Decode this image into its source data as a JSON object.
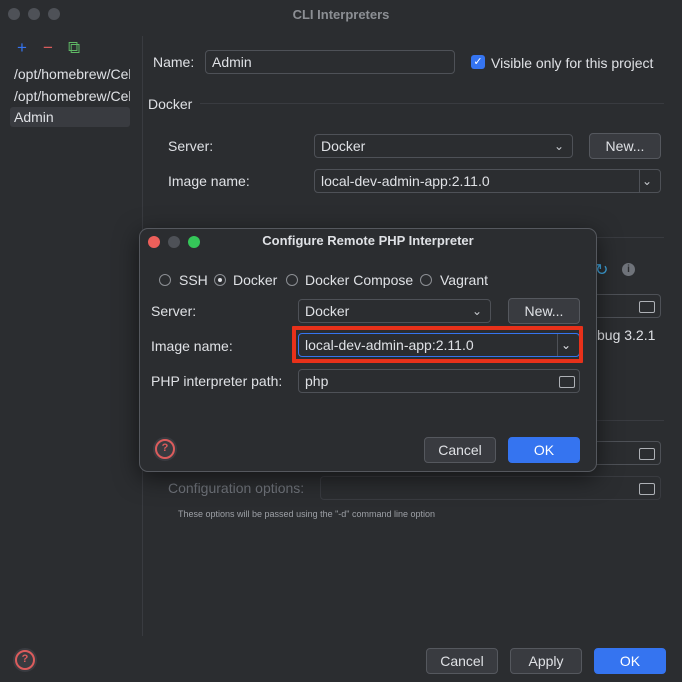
{
  "window": {
    "title": "CLI Interpreters"
  },
  "toolbar": {
    "add": "+",
    "remove": "−",
    "copy": "⧉"
  },
  "interpreters": [
    {
      "label": "/opt/homebrew/Cellar",
      "selected": false
    },
    {
      "label": "/opt/homebrew/Cellar",
      "selected": false
    },
    {
      "label": "Admin",
      "selected": true
    }
  ],
  "form": {
    "name_label": "Name:",
    "name_value": "Admin",
    "visible_label": "Visible only for this project",
    "visible_checked": true,
    "docker_section": "Docker",
    "server_label": "Server:",
    "server_value": "Docker",
    "new_label": "New...",
    "image_label": "Image name:",
    "image_value": "local-dev-admin-app:2.11.0",
    "debugger_partial": "bug 3.2.1",
    "config_label": "Configuration options:",
    "config_hint": "These options will be passed using the \"-d\" command line option"
  },
  "footer": {
    "cancel": "Cancel",
    "apply": "Apply",
    "ok": "OK",
    "help": "?"
  },
  "dialog": {
    "title": "Configure Remote PHP Interpreter",
    "radios": [
      {
        "label": "SSH",
        "checked": false
      },
      {
        "label": "Docker",
        "checked": true
      },
      {
        "label": "Docker Compose",
        "checked": false
      },
      {
        "label": "Vagrant",
        "checked": false
      }
    ],
    "server_label": "Server:",
    "server_value": "Docker",
    "new_label": "New...",
    "image_label": "Image name:",
    "image_value": "local-dev-admin-app:2.11.0",
    "php_path_label": "PHP interpreter path:",
    "php_path_value": "php",
    "cancel": "Cancel",
    "ok": "OK",
    "help": "?"
  },
  "colors": {
    "accent": "#3574f0",
    "highlight": "#e8311a",
    "background": "#2b2d30"
  },
  "icons": [
    "add-icon",
    "remove-icon",
    "copy-icon",
    "checkbox-icon",
    "chevron-down-icon",
    "folder-icon",
    "refresh-icon",
    "info-icon",
    "help-icon"
  ]
}
